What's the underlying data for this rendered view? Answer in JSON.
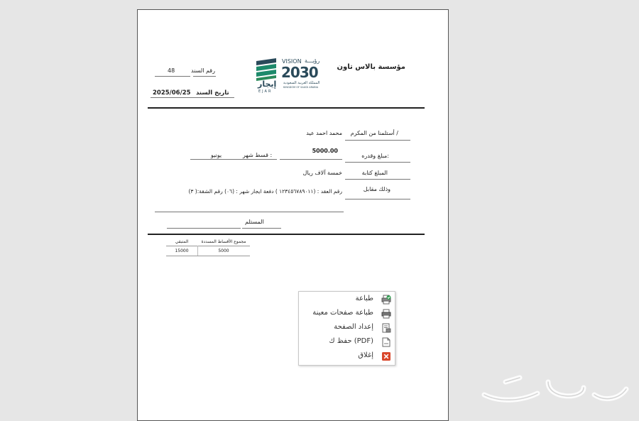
{
  "receipt": {
    "company_name": "مؤسسة بالاس تاون",
    "bond_number_label": "رقم السند",
    "bond_number_value": "48",
    "bond_date_label": "تاريخ السند",
    "bond_date_value": "2025/06/25",
    "received_from_label": "أستلمنا من المكرم /",
    "received_from_value": "محمد احمد عيد",
    "amount_label": "مبلغ وقدره:",
    "amount_value": "5000.00",
    "installment_label": "قسط شهر :",
    "installment_value": "يونيو",
    "amount_words_label": "المبلغ كتابة",
    "amount_words_value": "خمسة آلاف ريال",
    "for_label": "وذلك مقابل",
    "for_value": "رقم العقد : (١٢٣٤٥٦٧٨٩٠١١ ) دفعة ايجار شهر : (٠٦) رقم الشقة:( ٣)",
    "receiver_label": "المستلم"
  },
  "logo": {
    "vision_en": "VISION",
    "vision_ar": "رؤيـــة",
    "year": "2030",
    "kingdom_ar": "المملكة العربية السعودية",
    "kingdom_en": "KINGDOM OF SAUDI ARABIA",
    "ejar_ar": "إيجار",
    "ejar_en": "EJAR"
  },
  "summary_table": {
    "headers": [
      "مجموع الأقساط المسددة",
      "المتبقي"
    ],
    "rows": [
      [
        "5000",
        "15000"
      ]
    ]
  },
  "context_menu": {
    "items": [
      {
        "label": "طباعة",
        "icon": "print-check-icon"
      },
      {
        "label": "طباعة صفحات معينة",
        "icon": "printer-icon"
      },
      {
        "label": "إعداد الصفحة",
        "icon": "page-setup-icon"
      },
      {
        "label": "حفظ ك (PDF)",
        "icon": "save-pdf-icon"
      },
      {
        "label": "إغلاق",
        "icon": "close-icon"
      }
    ]
  },
  "colors": {
    "page_bg": "#ffffff",
    "screen_bg": "#e6e6e6",
    "logo_green": "#1d8a6b",
    "logo_dark": "#2a4a5a",
    "close_red": "#d9472b"
  }
}
